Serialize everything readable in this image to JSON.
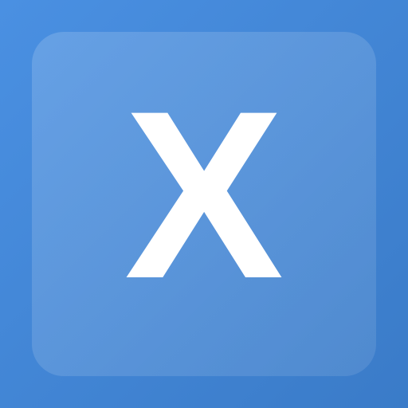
{
  "icon": {
    "letter": "X",
    "background_start": "#4a90e2",
    "background_end": "#3a7bc8",
    "letter_color": "#ffffff"
  }
}
